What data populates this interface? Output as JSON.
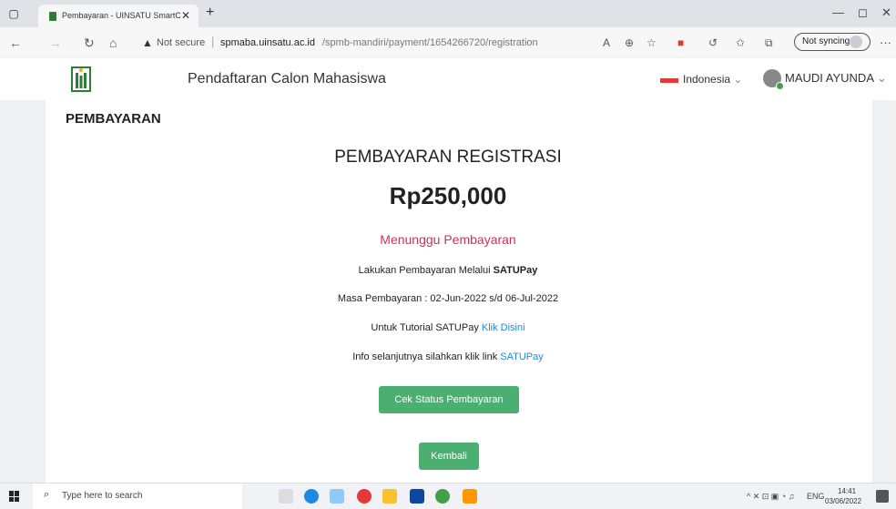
{
  "browser": {
    "tab_title": "Pembayaran - UINSATU SmartC",
    "security_label": "Not secure",
    "url_host": "spmaba.uinsatu.ac.id",
    "url_path": "/spmb-mandiri/payment/1654266720/registration",
    "sync_label": "Not syncing",
    "icons": [
      "back-icon",
      "forward-icon",
      "refresh-icon",
      "home-icon",
      "warning-icon",
      "read-aloud-icon",
      "zoom-icon",
      "favorites-star-icon",
      "extension-icon",
      "collections-icon",
      "more-icon"
    ]
  },
  "header": {
    "site_title": "Pendaftaran Calon Mahasiswa",
    "language": "Indonesia",
    "user_name": "MAUDI AYUNDA",
    "flag_color": "#e53935"
  },
  "main": {
    "section_title": "PEMBAYARAN",
    "heading": "PEMBAYARAN REGISTRASI",
    "amount": "Rp250,000",
    "status": "Menunggu Pembayaran",
    "line1_prefix": "Lakukan Pembayaran Melalui",
    "line1_bold": "SATUPay",
    "line2": "Masa Pembayaran : 02-Jun-2022 s/d 06-Jul-2022",
    "line3_prefix": "Untuk Tutorial SATUPay",
    "line3_link": "Klik Disini",
    "line4_prefix": "Info selanjutnya silahkan klik link",
    "line4_link": "SATUPay",
    "check_button": "Cek Status Pembayaran",
    "back_button": "Kembali",
    "colors": {
      "status": "#d32f55",
      "button": "#4caf72",
      "link": "#1e88e5"
    }
  },
  "taskbar": {
    "search_placeholder": "Type here to search",
    "lang": "ENG",
    "time": "14:41",
    "date": "03/06/2022"
  }
}
